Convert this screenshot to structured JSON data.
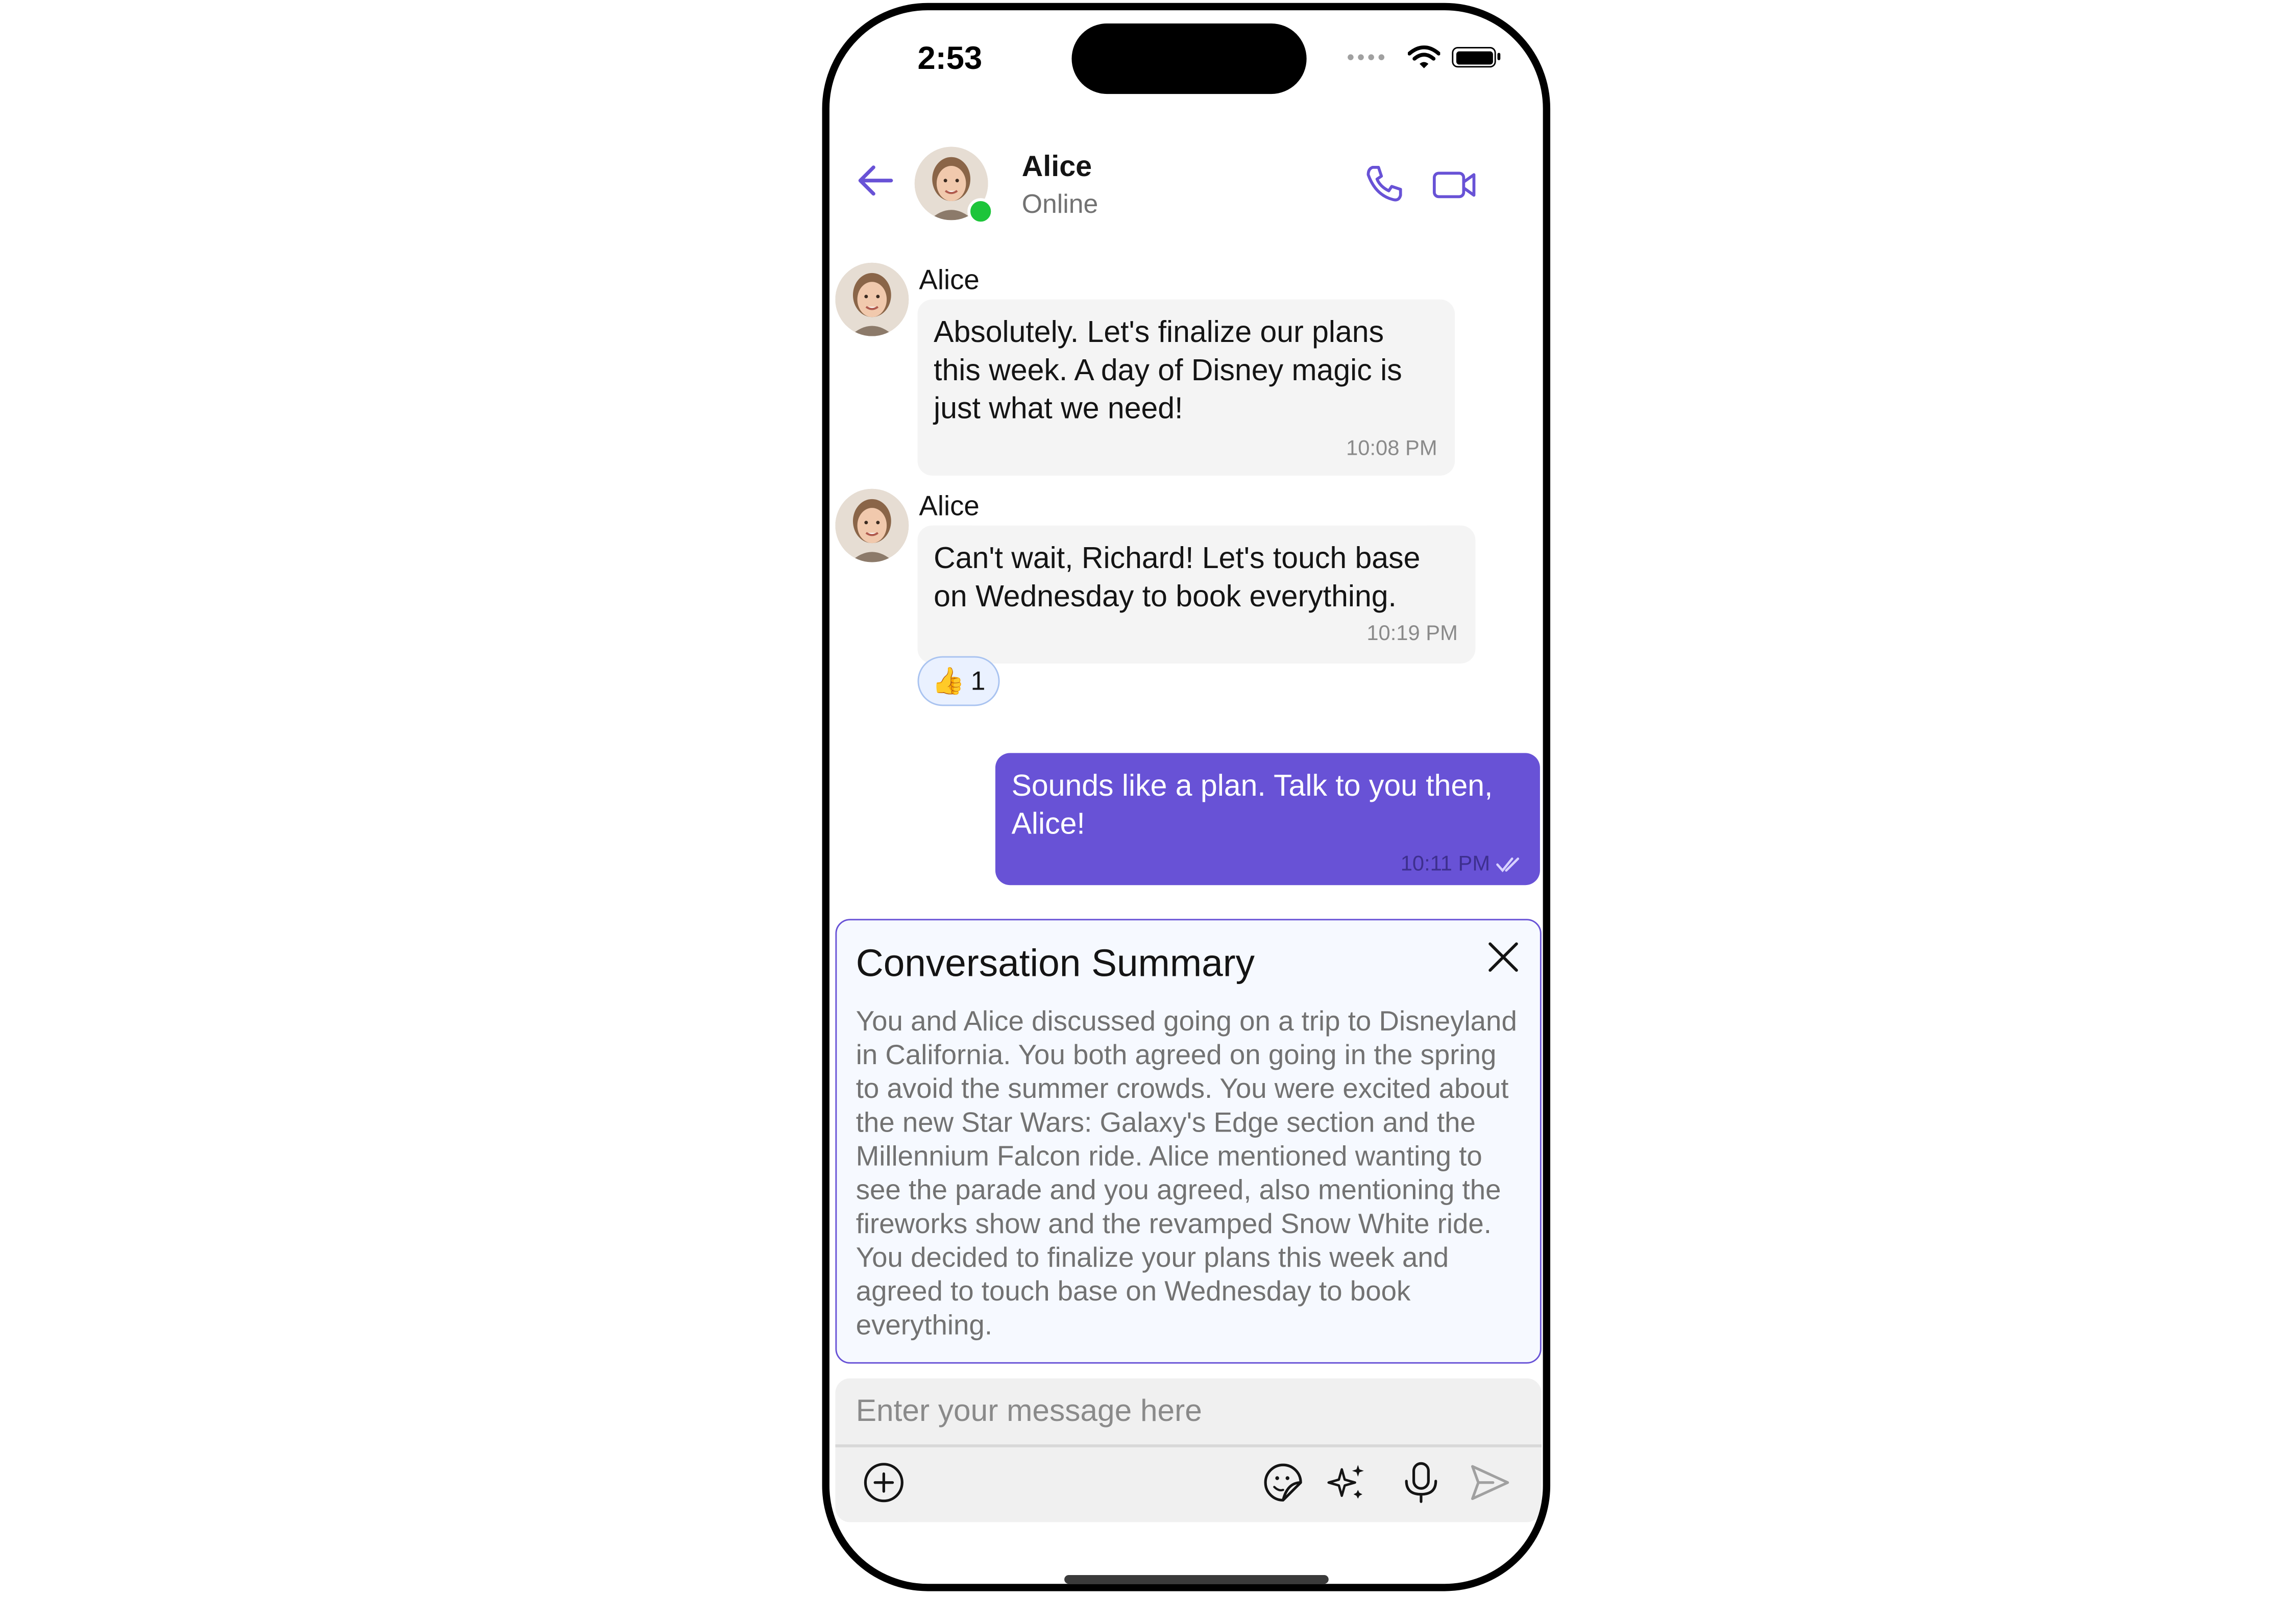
{
  "status_bar": {
    "time": "2:53"
  },
  "header": {
    "name": "Alice",
    "status": "Online"
  },
  "messages": [
    {
      "sender": "Alice",
      "text": "Absolutely. Let's finalize our plans this week. A day of Disney magic is just what we need!",
      "time": "10:08 PM"
    },
    {
      "sender": "Alice",
      "text": "Can't wait, Richard! Let's touch base on Wednesday to book everything.",
      "time": "10:19 PM",
      "reaction": {
        "emoji": "👍",
        "count": "1"
      }
    },
    {
      "text": "Sounds like a plan. Talk to you then, Alice!",
      "time": "10:11 PM"
    }
  ],
  "summary": {
    "title": "Conversation Summary",
    "body": "You and Alice discussed going on a trip to Disneyland in California. You both agreed on going in the spring to avoid the summer crowds. You were excited about the new Star Wars: Galaxy's Edge section and the Millennium Falcon ride. Alice mentioned wanting to see the parade and you agreed, also mentioning the fireworks show and the revamped Snow White ride. You decided to finalize your plans this week and agreed to touch base on Wednesday to book everything."
  },
  "composer": {
    "placeholder": "Enter your message here"
  },
  "colors": {
    "accent": "#6852d6",
    "online": "#1dc53a",
    "incoming_bubble": "#f4f4f4",
    "summary_bg": "#f6f9ff"
  },
  "icons": [
    "back-arrow-icon",
    "phone-icon",
    "video-camera-icon",
    "close-icon",
    "add-circle-icon",
    "sticker-icon",
    "ai-sparkle-icon",
    "microphone-icon",
    "send-icon",
    "double-check-icon",
    "wifi-icon",
    "battery-icon"
  ]
}
